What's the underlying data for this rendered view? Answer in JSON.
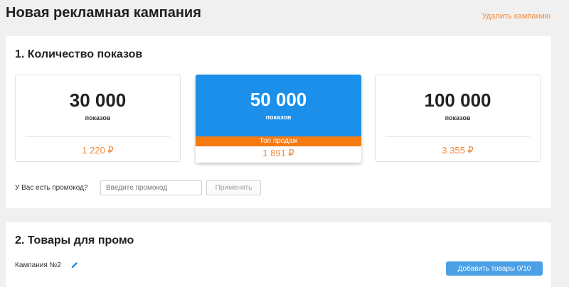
{
  "page": {
    "title": "Новая рекламная кампания",
    "delete_link": "Удалить кампанию"
  },
  "impressions": {
    "section_title": "1. Количество показов",
    "tiers": [
      {
        "count": "30 000",
        "unit": "показов",
        "price": "1 220 ₽",
        "selected": false
      },
      {
        "count": "50 000",
        "unit": "показов",
        "price": "1 891 ₽",
        "badge": "Топ продаж",
        "selected": true
      },
      {
        "count": "100 000",
        "unit": "показов",
        "price": "3 355 ₽",
        "selected": false
      }
    ],
    "promo": {
      "label": "У Вас есть промокод?",
      "placeholder": "Введите промокод",
      "value": "",
      "apply_label": "Применить"
    }
  },
  "goods": {
    "section_title": "2. Товары для промо",
    "campaign_name": "Кампания №2",
    "add_button_label": "Добавить товары 0/10"
  },
  "colors": {
    "accent_orange": "#f08a3c",
    "selected_blue": "#1b8fea",
    "badge_orange": "#f57a10",
    "button_blue": "#4ba0e6"
  },
  "icons": {
    "edit": "pencil-icon"
  }
}
